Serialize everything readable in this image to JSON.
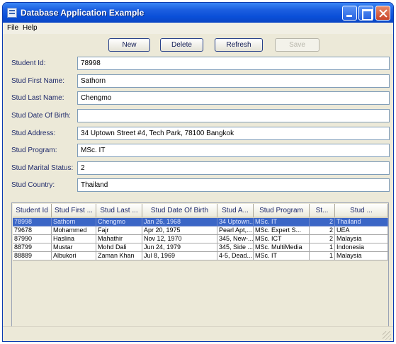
{
  "window": {
    "title": "Database Application Example"
  },
  "menu": {
    "items": [
      "File",
      "Help"
    ]
  },
  "toolbar": {
    "new_label": "New",
    "delete_label": "Delete",
    "refresh_label": "Refresh",
    "save_label": "Save"
  },
  "form": {
    "fields": [
      {
        "label": "Student Id:",
        "value": "78998"
      },
      {
        "label": "Stud First Name:",
        "value": "Sathorn"
      },
      {
        "label": "Stud Last Name:",
        "value": "Chengmo"
      },
      {
        "label": "Stud Date Of Birth:",
        "value": ""
      },
      {
        "label": "Stud Address:",
        "value": "34 Uptown Street #4, Tech Park, 78100 Bangkok"
      },
      {
        "label": "Stud Program:",
        "value": "MSc. IT"
      },
      {
        "label": "Stud Marital Status:",
        "value": "2"
      },
      {
        "label": "Stud Country:",
        "value": "Thailand"
      }
    ]
  },
  "table": {
    "columns": [
      "Student Id",
      "Stud First ...",
      "Stud Last ...",
      "Stud Date Of Birth",
      "Stud A...",
      "Stud Program",
      "St...",
      "Stud ..."
    ],
    "rows": [
      [
        "78998",
        "Sathorn",
        "Chengmo",
        "Jan 26, 1968",
        "34 Uptown...",
        "MSc. IT",
        "2",
        "Thailand"
      ],
      [
        "79678",
        "Mohammed",
        "Fajr",
        "Apr 20, 1975",
        "Pearl Apt,...",
        "MSc. Expert S...",
        "2",
        "UEA"
      ],
      [
        "87990",
        "Haslina",
        "Mahathir",
        "Nov 12, 1970",
        "345, New-...",
        "MSc. ICT",
        "2",
        "Malaysia"
      ],
      [
        "88799",
        "Mustar",
        "Mohd Dali",
        "Jun 24, 1979",
        "345, Side ...",
        "MSc. MultiMedia",
        "1",
        "Indonesia"
      ],
      [
        "88889",
        "Albukori",
        "Zaman Khan",
        "Jul 8, 1969",
        "4-5, Dead...",
        "MSc. IT",
        "1",
        "Malaysia"
      ]
    ],
    "selected_row": 0
  },
  "colors": {
    "titlebar": "#0a4fd8",
    "selection": "#3b66c6",
    "window_bg": "#ece9d8"
  }
}
